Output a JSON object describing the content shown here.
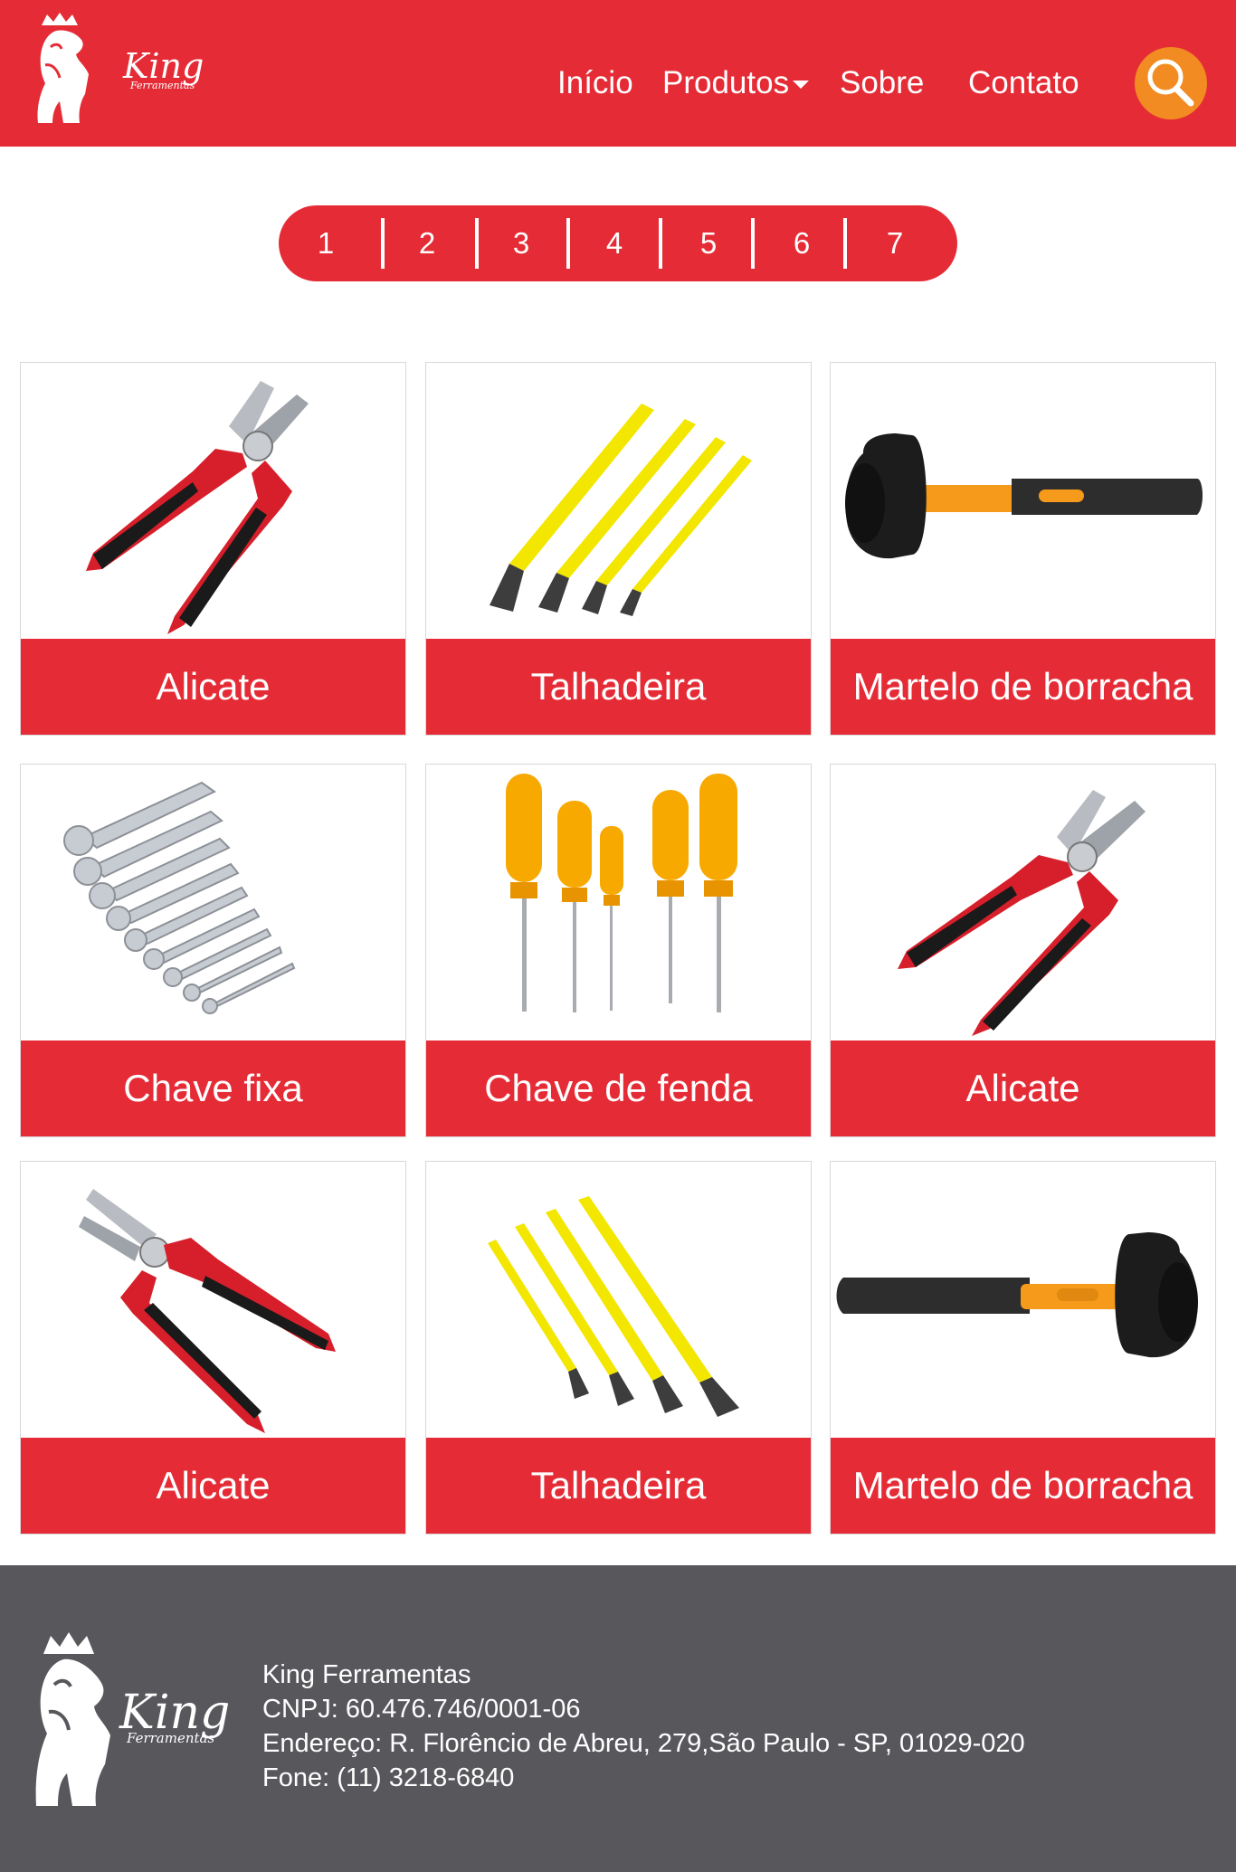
{
  "brand": {
    "name": "King",
    "subtitle": "Ferramentas",
    "color": "#e52c36",
    "accent": "#f28c22"
  },
  "nav": {
    "inicio": "Início",
    "produtos": "Produtos",
    "sobre": "Sobre",
    "contato": "Contato",
    "search_icon": "search-icon"
  },
  "pagination": [
    "1",
    "2",
    "3",
    "4",
    "5",
    "6",
    "7"
  ],
  "products": [
    {
      "label": "Alicate",
      "icon": "pliers"
    },
    {
      "label": "Talhadeira",
      "icon": "chisel-set"
    },
    {
      "label": "Martelo de borracha",
      "icon": "rubber-mallet"
    },
    {
      "label": "Chave fixa",
      "icon": "wrench-set"
    },
    {
      "label": "Chave de fenda",
      "icon": "screwdriver-set"
    },
    {
      "label": "Alicate",
      "icon": "pliers"
    },
    {
      "label": "Alicate",
      "icon": "pliers"
    },
    {
      "label": "Talhadeira",
      "icon": "chisel-set"
    },
    {
      "label": "Martelo de borracha",
      "icon": "rubber-mallet"
    }
  ],
  "footer": {
    "company": "King Ferramentas",
    "cnpj": "CNPJ: 60.476.746/0001-06",
    "address": "Endereço: R. Florêncio de Abreu, 279,São Paulo - SP, 01029-020",
    "phone": "Fone:  (11) 3218-6840"
  }
}
